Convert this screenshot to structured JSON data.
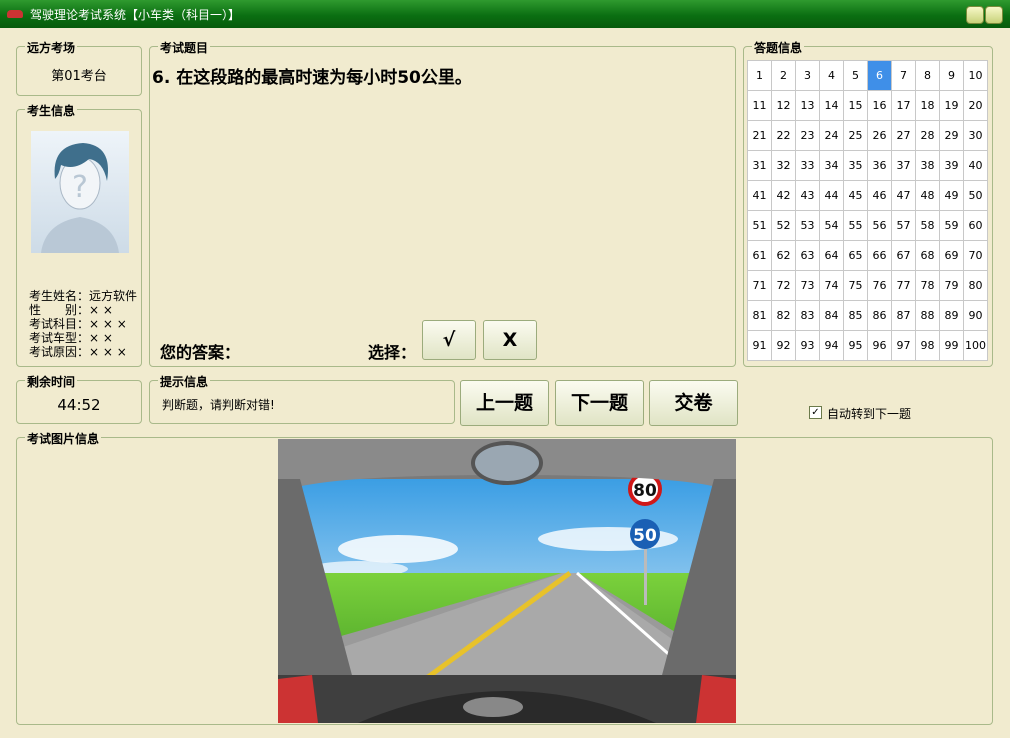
{
  "window": {
    "title": "驾驶理论考试系统【小车类（科目一）】"
  },
  "venue": {
    "label": "远方考场",
    "value": "第01考台"
  },
  "examinee": {
    "label": "考生信息",
    "lines": [
      "考生姓名：远方软件",
      "性　　别：× ×",
      "考试科目：× × ×",
      "考试车型：× ×",
      "考试原因：× × ×"
    ]
  },
  "question": {
    "label": "考试题目",
    "text": "6. 在这段路的最高时速为每小时50公里。",
    "answer_label": "您的答案：",
    "choose_label": "选择：",
    "true_btn": "√",
    "false_btn": "X"
  },
  "answers": {
    "label": "答题信息",
    "current": 6,
    "numbers": [
      "1",
      "2",
      "3",
      "4",
      "5",
      "6",
      "7",
      "8",
      "9",
      "10",
      "11",
      "12",
      "13",
      "14",
      "15",
      "16",
      "17",
      "18",
      "19",
      "20",
      "21",
      "22",
      "23",
      "24",
      "25",
      "26",
      "27",
      "28",
      "29",
      "30",
      "31",
      "32",
      "33",
      "34",
      "35",
      "36",
      "37",
      "38",
      "39",
      "40",
      "41",
      "42",
      "43",
      "44",
      "45",
      "46",
      "47",
      "48",
      "49",
      "50",
      "51",
      "52",
      "53",
      "54",
      "55",
      "56",
      "57",
      "58",
      "59",
      "60",
      "61",
      "62",
      "63",
      "64",
      "65",
      "66",
      "67",
      "68",
      "69",
      "70",
      "71",
      "72",
      "73",
      "74",
      "75",
      "76",
      "77",
      "78",
      "79",
      "80",
      "81",
      "82",
      "83",
      "84",
      "85",
      "86",
      "87",
      "88",
      "89",
      "90",
      "91",
      "92",
      "93",
      "94",
      "95",
      "96",
      "97",
      "98",
      "99",
      "100"
    ]
  },
  "timer": {
    "label": "剩余时间",
    "value": "44:52"
  },
  "hint": {
    "label": "提示信息",
    "text": "判断题，请判断对错!"
  },
  "nav": {
    "prev": "上一题",
    "next": "下一题",
    "submit": "交卷"
  },
  "auto_next": {
    "label": "自动转到下一题",
    "checked": true
  },
  "image_section": {
    "label": "考试图片信息",
    "signs": [
      "80",
      "50"
    ]
  },
  "colors": {
    "titlebar": "#0b6f12",
    "selected": "#3f8fe8",
    "panel": "#f1ebcf"
  }
}
